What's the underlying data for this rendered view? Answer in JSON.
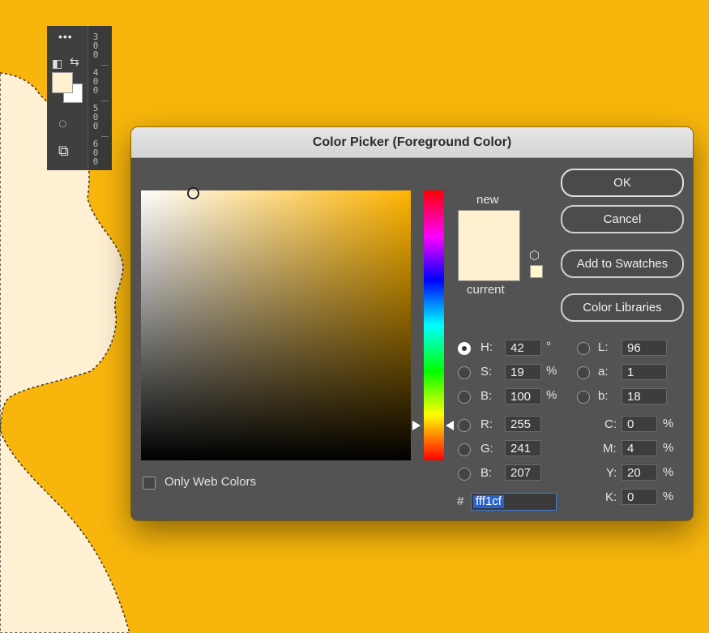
{
  "colors": {
    "background": "#f8b60c",
    "silhouette": "#fff0d3",
    "foreground": "#fff1cf",
    "dialog_bg": "#535353",
    "accent": "#2a62c9"
  },
  "ruler": {
    "numbers": [
      "300",
      "400",
      "500",
      "600"
    ]
  },
  "toolbar": {
    "more_glyph": "•••",
    "swap_glyph": "⇆",
    "default_glyph": "◧",
    "mask_glyph": "◌",
    "screen_glyph": "⧉"
  },
  "dialog": {
    "title": "Color Picker (Foreground Color)",
    "new_label": "new",
    "current_label": "current",
    "buttons": {
      "ok": "OK",
      "cancel": "Cancel",
      "add_swatches": "Add to Swatches",
      "color_libraries": "Color Libraries"
    },
    "only_web_colors": "Only Web Colors",
    "gamut_glyph": "⬡",
    "hsb": [
      {
        "label": "H:",
        "value": "42",
        "unit": "°",
        "selected": true
      },
      {
        "label": "S:",
        "value": "19",
        "unit": "%",
        "selected": false
      },
      {
        "label": "B:",
        "value": "100",
        "unit": "%",
        "selected": false
      }
    ],
    "rgb": [
      {
        "label": "R:",
        "value": "255"
      },
      {
        "label": "G:",
        "value": "241"
      },
      {
        "label": "B:",
        "value": "207"
      }
    ],
    "lab": [
      {
        "label": "L:",
        "value": "96"
      },
      {
        "label": "a:",
        "value": "1"
      },
      {
        "label": "b:",
        "value": "18"
      }
    ],
    "cmyk": [
      {
        "label": "C:",
        "value": "0",
        "unit": "%"
      },
      {
        "label": "M:",
        "value": "4",
        "unit": "%"
      },
      {
        "label": "Y:",
        "value": "20",
        "unit": "%"
      },
      {
        "label": "K:",
        "value": "0",
        "unit": "%"
      }
    ],
    "hex_prefix": "#",
    "hex_value": "fff1cf"
  }
}
